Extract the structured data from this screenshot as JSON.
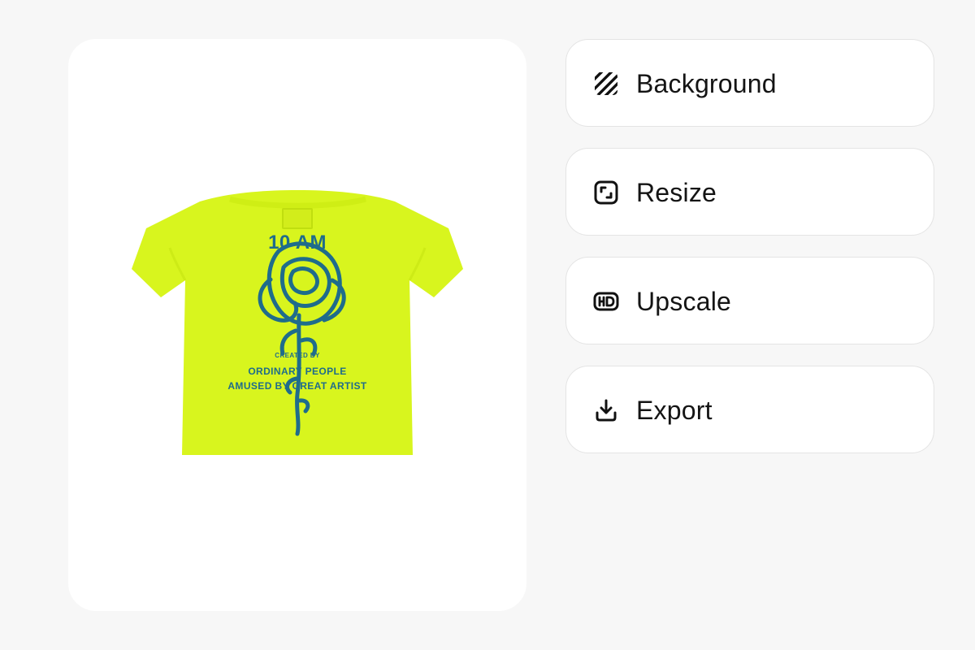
{
  "colors": {
    "page_background": "#f7f7f7",
    "card_background": "#ffffff",
    "button_border": "#e4e4e4",
    "text": "#141414",
    "shirt": "#d8f51e",
    "print": "#1f6c8b"
  },
  "preview": {
    "image_semantic": "neon-yellow-tshirt-back-print",
    "print_text": {
      "title": "10 AM",
      "created": "CREATED BY",
      "line1": "ORDINARY PEOPLE",
      "line2": "AMUSED BY GREAT ARTIST"
    }
  },
  "actions": [
    {
      "label": "Background",
      "icon": "striped-square-icon"
    },
    {
      "label": "Resize",
      "icon": "resize-frame-icon"
    },
    {
      "label": "Upscale",
      "icon": "hd-badge-icon"
    },
    {
      "label": "Export",
      "icon": "download-icon"
    }
  ]
}
